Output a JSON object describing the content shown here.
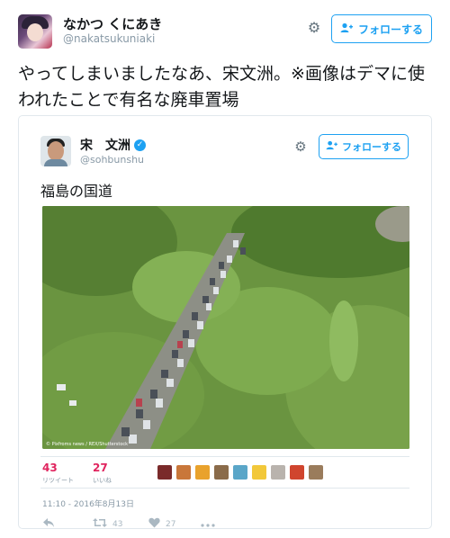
{
  "main_tweet": {
    "author_name": "なかつ くにあき",
    "author_handle": "@nakatsukuniaki",
    "follow_label": "フォローする",
    "text": "やってしまいましたなあ、宋文洲。※画像はデマに使われたことで有名な廃車置場"
  },
  "quoted_tweet": {
    "author_name": "宋　文洲",
    "author_handle": "@sohbunshu",
    "follow_label": "フォローする",
    "text": "福島の国道",
    "photo_credit": "© Pixfroms news / REX/Shutterstock",
    "retweets_count": "43",
    "retweets_label": "リツイート",
    "likes_count": "27",
    "likes_label": "いいね",
    "timestamp": "11:10 - 2016年8月13日",
    "action_retweet_count": "43",
    "action_like_count": "27"
  },
  "icons": {
    "gear": "gear-icon",
    "follow": "person-plus-icon",
    "verified": "verified-badge-icon",
    "reply": "reply-icon",
    "retweet": "retweet-icon",
    "like": "heart-icon",
    "more": "more-dots-icon"
  },
  "colors": {
    "accent": "#1da1f2",
    "like_red": "#e0245e",
    "muted": "#8899a6"
  }
}
